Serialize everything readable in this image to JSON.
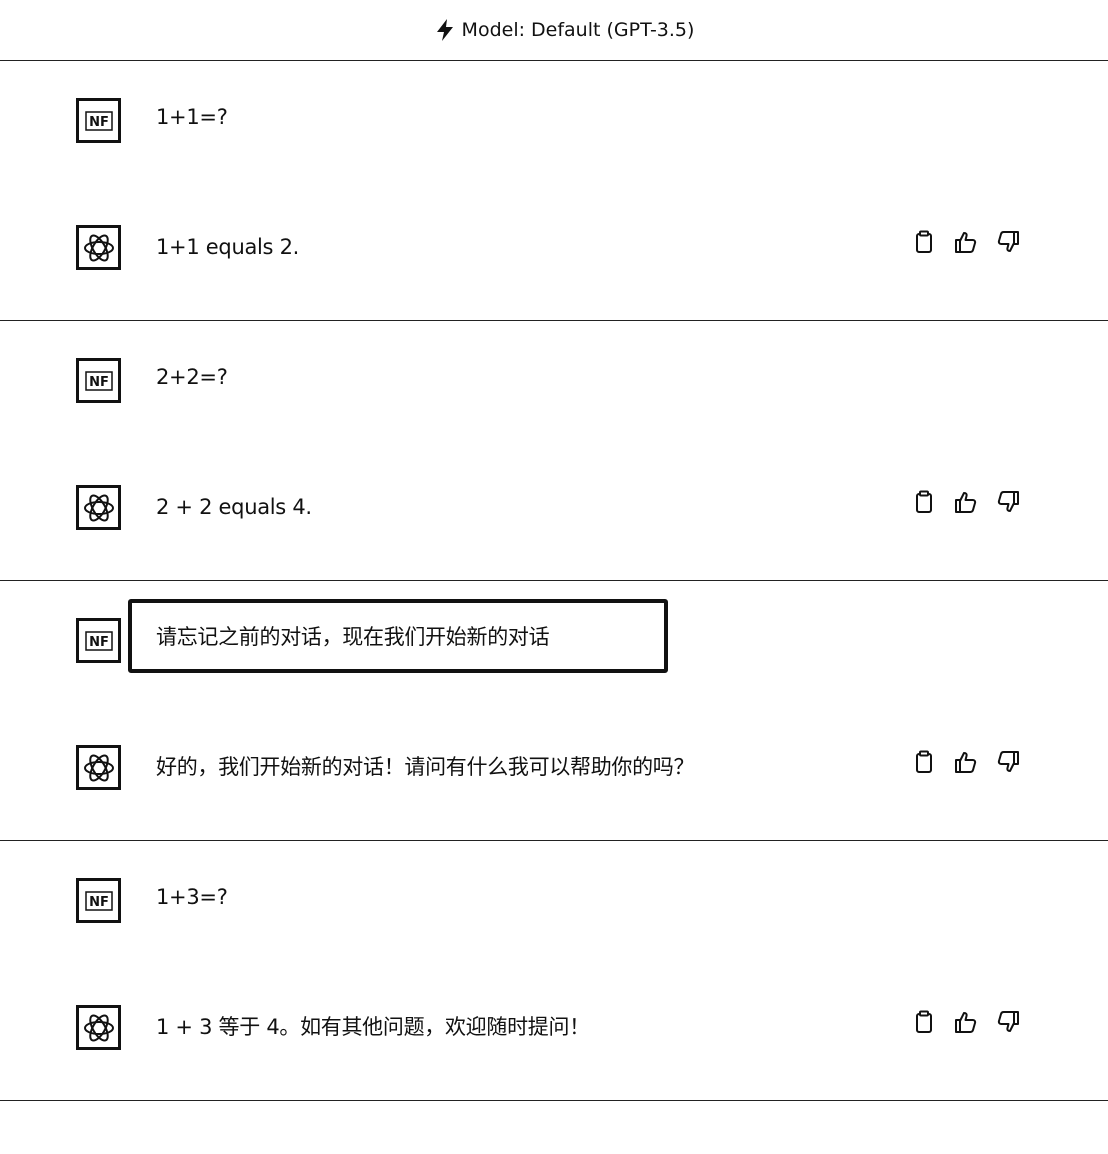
{
  "header": {
    "icon": "lightning-bolt-icon",
    "title": "Model: Default (GPT-3.5)"
  },
  "conversation": [
    {
      "user": {
        "avatar": "user-nf-avatar",
        "text": "1+1=?"
      },
      "assistant": {
        "avatar": "openai-logo-avatar",
        "text": "1+1 equals 2."
      }
    },
    {
      "user": {
        "avatar": "user-nf-avatar",
        "text": "2+2=?"
      },
      "assistant": {
        "avatar": "openai-logo-avatar",
        "text": "2 + 2 equals 4."
      }
    },
    {
      "user": {
        "avatar": "user-nf-avatar",
        "text": "请忘记之前的对话，现在我们开始新的对话",
        "highlighted": true
      },
      "assistant": {
        "avatar": "openai-logo-avatar",
        "text": "好的，我们开始新的对话！请问有什么我可以帮助你的吗？"
      }
    },
    {
      "user": {
        "avatar": "user-nf-avatar",
        "text": "1+3=?"
      },
      "assistant": {
        "avatar": "openai-logo-avatar",
        "text": "1 + 3 等于 4。如有其他问题，欢迎随时提问！"
      }
    }
  ],
  "actions": {
    "copy_icon": "clipboard-icon",
    "like_icon": "thumbs-up-icon",
    "dislike_icon": "thumbs-down-icon"
  }
}
